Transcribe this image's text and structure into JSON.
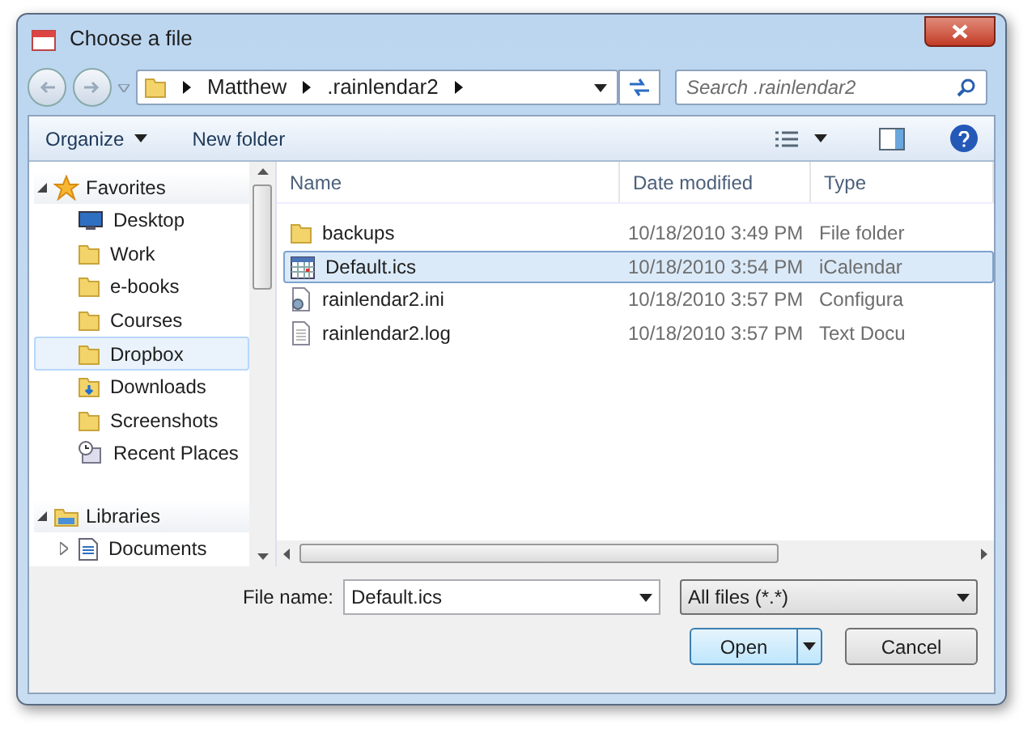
{
  "window": {
    "title": "Choose a file"
  },
  "address": {
    "crumbs": [
      "Matthew",
      ".rainlendar2"
    ]
  },
  "search": {
    "placeholder": "Search .rainlendar2"
  },
  "toolbar": {
    "items": [
      {
        "label": "Organize",
        "kind": "menu"
      },
      {
        "label": "New folder",
        "kind": "plain"
      }
    ]
  },
  "navigation": {
    "groups": [
      {
        "label": "Favorites",
        "kind": "star",
        "expanded": true,
        "children": [
          {
            "label": "Desktop",
            "kind": "desktop",
            "selected": false
          },
          {
            "label": "Work",
            "kind": "folder",
            "selected": false
          },
          {
            "label": "e-books",
            "kind": "folder",
            "selected": false
          },
          {
            "label": "Courses",
            "kind": "folder",
            "selected": false
          },
          {
            "label": "Dropbox",
            "kind": "folder",
            "selected": true
          },
          {
            "label": "Downloads",
            "kind": "download",
            "selected": false
          },
          {
            "label": "Screenshots",
            "kind": "folder",
            "selected": false
          },
          {
            "label": "Recent Places",
            "kind": "recent",
            "selected": false
          }
        ]
      },
      {
        "label": "Libraries",
        "kind": "library",
        "expanded": true,
        "children": [
          {
            "label": "Documents",
            "kind": "document",
            "selected": false,
            "expanded": false
          }
        ]
      }
    ]
  },
  "table": {
    "columns": [
      "Name",
      "Date modified",
      "Type"
    ],
    "rows": [
      {
        "name": "backups",
        "kind": "folder",
        "date": "10/18/2010 3:49 PM",
        "type": "File folder",
        "selected": false
      },
      {
        "name": "Default.ics",
        "kind": "calendar",
        "date": "10/18/2010 3:54 PM",
        "type": "iCalendar",
        "selected": true
      },
      {
        "name": "rainlendar2.ini",
        "kind": "config",
        "date": "10/18/2010 3:57 PM",
        "type": "Configura",
        "selected": false
      },
      {
        "name": "rainlendar2.log",
        "kind": "text",
        "date": "10/18/2010 3:57 PM",
        "type": "Text Docu",
        "selected": false
      }
    ]
  },
  "file_name": {
    "label": "File name:",
    "value": "Default.ics"
  },
  "file_type": {
    "value": "All files (*.*)"
  },
  "buttons": [
    {
      "label": "Open",
      "kind": "split"
    },
    {
      "label": "Cancel",
      "kind": "plain"
    }
  ]
}
